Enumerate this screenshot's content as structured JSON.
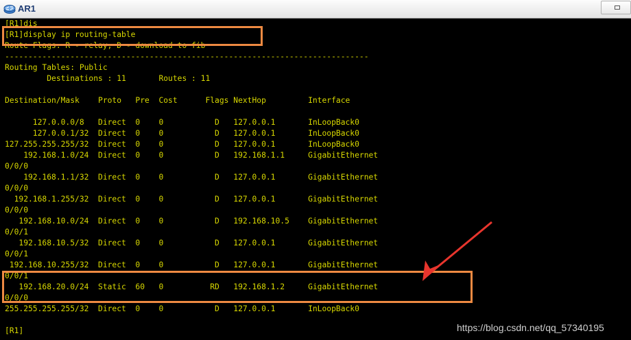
{
  "window": {
    "title": "AR1",
    "icon": "router-icon"
  },
  "terminal": {
    "lines": [
      "[R1]dis",
      "[R1]display ip routing-table",
      "Route Flags: R - relay, D - download to fib",
      "------------------------------------------------------------------------------",
      "Routing Tables: Public",
      "         Destinations : 11       Routes : 11",
      "",
      "Destination/Mask    Proto   Pre  Cost      Flags NextHop         Interface",
      "",
      "      127.0.0.0/8   Direct  0    0           D   127.0.0.1       InLoopBack0",
      "      127.0.0.1/32  Direct  0    0           D   127.0.0.1       InLoopBack0",
      "127.255.255.255/32  Direct  0    0           D   127.0.0.1       InLoopBack0",
      "    192.168.1.0/24  Direct  0    0           D   192.168.1.1     GigabitEthernet",
      "0/0/0",
      "    192.168.1.1/32  Direct  0    0           D   127.0.0.1       GigabitEthernet",
      "0/0/0",
      "  192.168.1.255/32  Direct  0    0           D   127.0.0.1       GigabitEthernet",
      "0/0/0",
      "   192.168.10.0/24  Direct  0    0           D   192.168.10.5    GigabitEthernet",
      "0/0/1",
      "   192.168.10.5/32  Direct  0    0           D   127.0.0.1       GigabitEthernet",
      "0/0/1",
      " 192.168.10.255/32  Direct  0    0           D   127.0.0.1       GigabitEthernet",
      "0/0/1",
      "   192.168.20.0/24  Static  60   0          RD   192.168.1.2     GigabitEthernet",
      "0/0/0",
      "255.255.255.255/32  Direct  0    0           D   127.0.0.1       InLoopBack0",
      "",
      "[R1]"
    ]
  },
  "watermark": "https://blog.csdn.net/qq_57340195",
  "colors": {
    "terminal_text": "#d8d800",
    "terminal_bg": "#000000",
    "highlight": "#ee8a42",
    "arrow": "#e8352d"
  }
}
